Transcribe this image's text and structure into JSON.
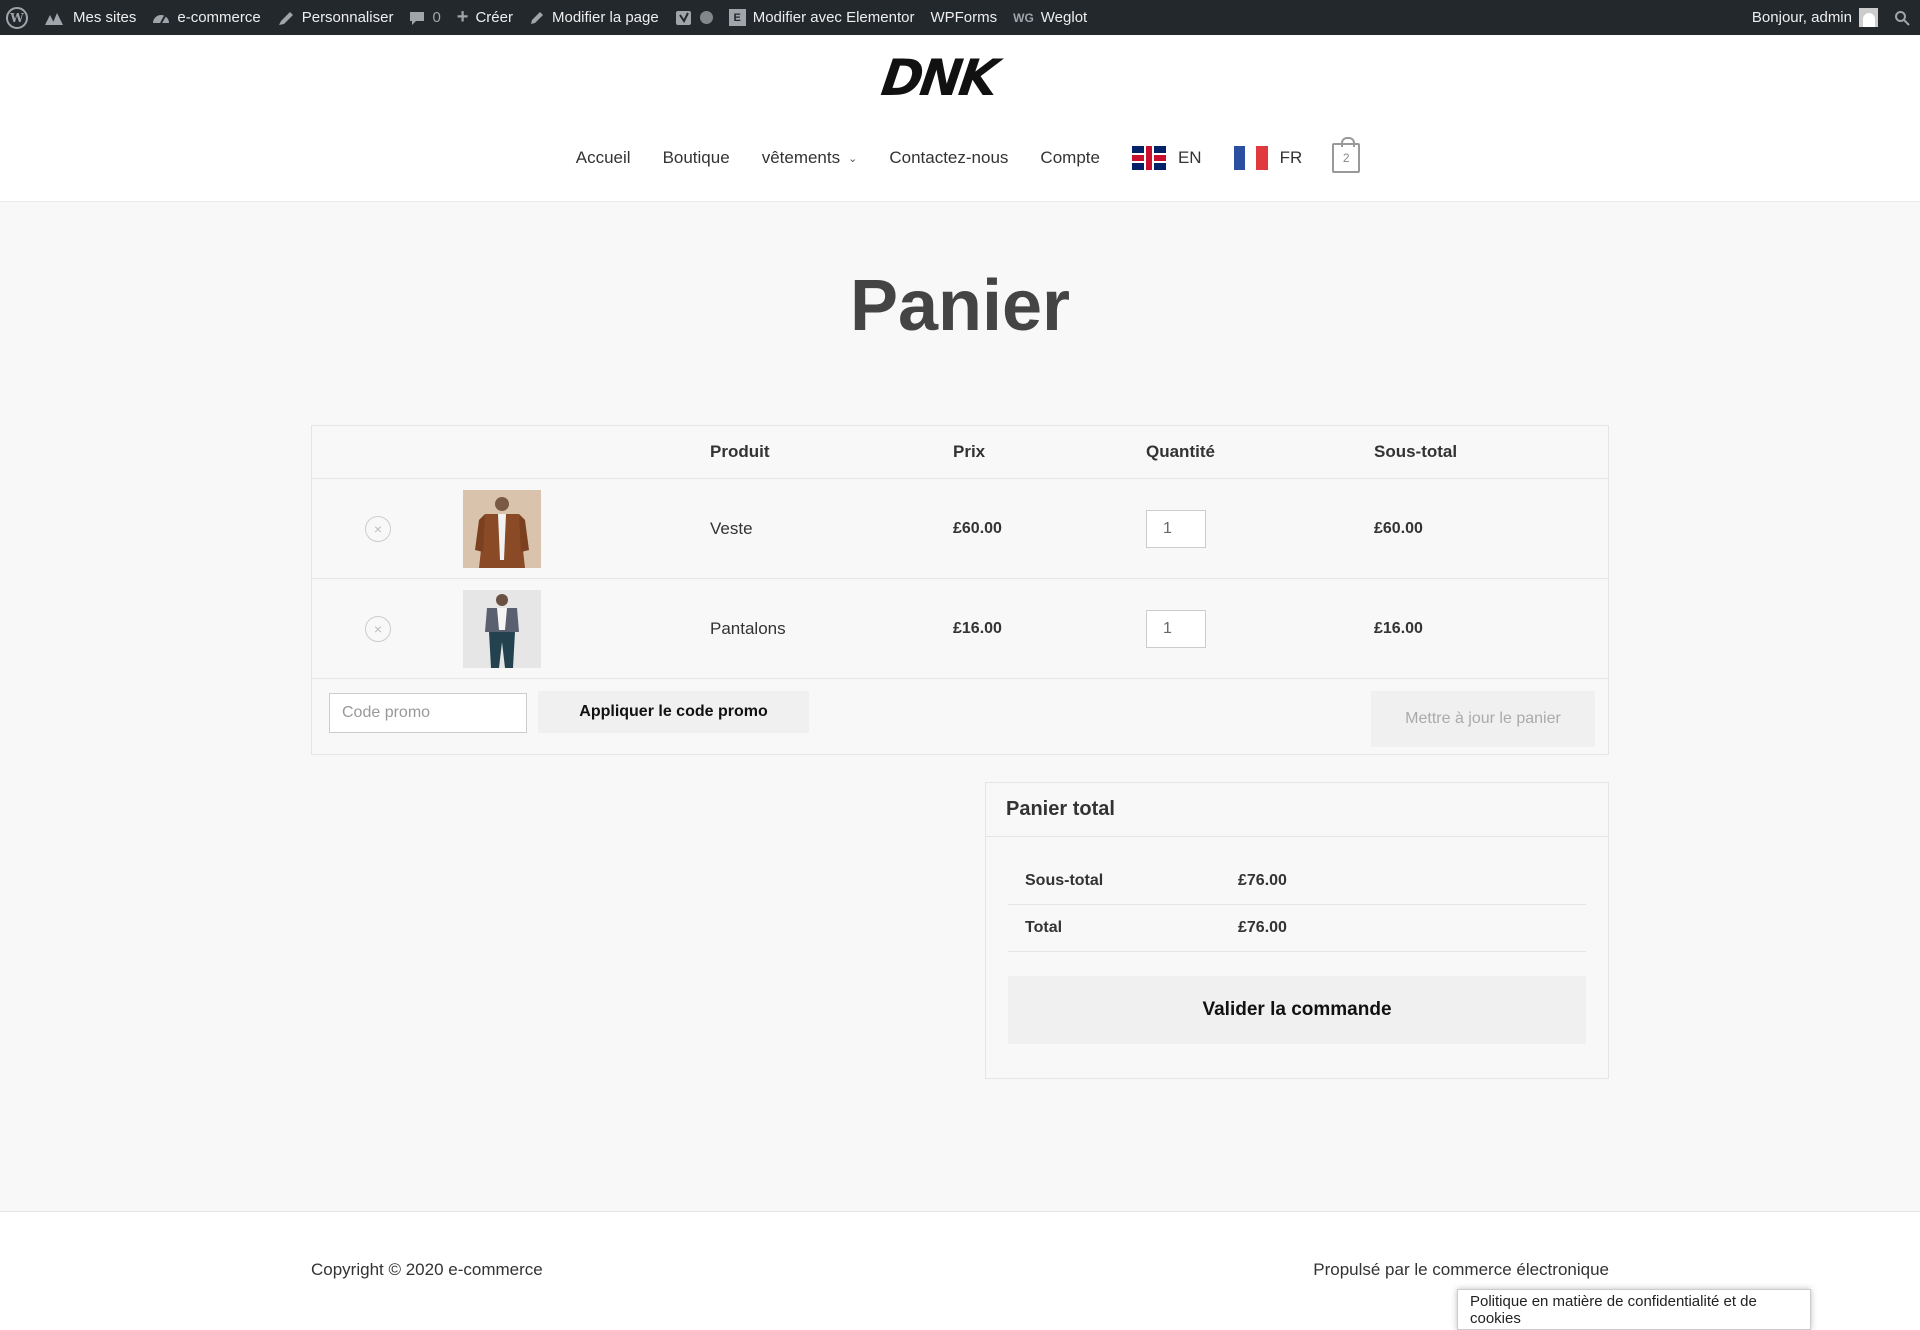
{
  "adminbar": {
    "items": [
      {
        "label": "Mes sites",
        "icon": "sites-icon"
      },
      {
        "label": "e-commerce",
        "icon": "dashboard-icon"
      },
      {
        "label": "Personnaliser",
        "icon": "brush-icon"
      },
      {
        "label": "0",
        "icon": "comment-icon"
      },
      {
        "label": "Créer",
        "icon": "plus-icon"
      },
      {
        "label": "Modifier la page",
        "icon": "pencil-icon"
      },
      {
        "label": "Modifier avec Elementor",
        "icon": "elementor-icon"
      },
      {
        "label": "WPForms"
      },
      {
        "label": "Weglot",
        "icon_text": "WG"
      }
    ],
    "greeting": "Bonjour, admin"
  },
  "header": {
    "logo": "DNK",
    "nav": [
      "Accueil",
      "Boutique",
      "vêtements",
      "Contactez-nous",
      "Compte"
    ],
    "lang_en": "EN",
    "lang_fr": "FR",
    "cart_count": "2"
  },
  "page": {
    "title": "Panier"
  },
  "cart": {
    "columns": {
      "product": "Produit",
      "price": "Prix",
      "quantity": "Quantité",
      "subtotal": "Sous-total"
    },
    "items": [
      {
        "name": "Veste",
        "price": "£60.00",
        "qty": "1",
        "subtotal": "£60.00"
      },
      {
        "name": "Pantalons",
        "price": "£16.00",
        "qty": "1",
        "subtotal": "£16.00"
      }
    ],
    "coupon_placeholder": "Code promo",
    "apply_label": "Appliquer le code promo",
    "update_label": "Mettre à jour le panier"
  },
  "totals": {
    "heading": "Panier total",
    "subtotal_label": "Sous-total",
    "subtotal_value": "£76.00",
    "total_label": "Total",
    "total_value": "£76.00",
    "checkout_label": "Valider la commande"
  },
  "footer": {
    "copyright": "Copyright © 2020 e-commerce",
    "powered": "Propulsé par le commerce électronique",
    "privacy": "Politique en matière de confidentialité et de cookies"
  },
  "colors": {
    "adminbar_bg": "#23282d",
    "page_bg": "#f8f8f8",
    "flag_fr_blue": "#2a4fa0",
    "flag_fr_red": "#e03a3e"
  }
}
